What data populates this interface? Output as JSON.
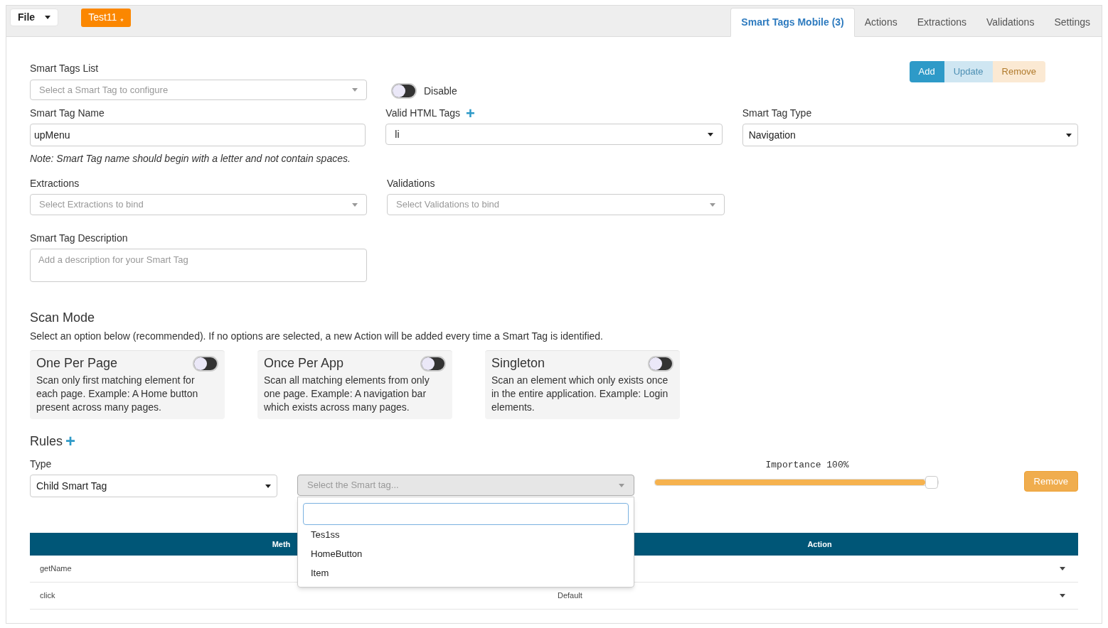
{
  "toolbar": {
    "file_menu": "File",
    "doc_tab": {
      "label": "Test11",
      "modified_mark": "*"
    }
  },
  "tabs": [
    {
      "label": "Smart Tags Mobile (3)",
      "selected": true
    },
    {
      "label": "Actions",
      "selected": false
    },
    {
      "label": "Extractions",
      "selected": false
    },
    {
      "label": "Validations",
      "selected": false
    },
    {
      "label": "Settings",
      "selected": false
    }
  ],
  "smart_tags_list": {
    "label": "Smart Tags List",
    "placeholder": "Select a Smart Tag to configure"
  },
  "disable_toggle": {
    "label": "Disable",
    "on": false
  },
  "action_buttons": [
    {
      "label": "Add",
      "kind": "primary",
      "disabled": false
    },
    {
      "label": "Update",
      "kind": "info",
      "disabled": true
    },
    {
      "label": "Remove",
      "kind": "warning",
      "disabled": true
    }
  ],
  "smart_tag_name": {
    "label": "Smart Tag Name",
    "value": "upMenu",
    "note": "Note: Smart Tag name should begin with a letter and not contain spaces."
  },
  "valid_html_tags": {
    "label": "Valid HTML Tags",
    "add_icon": "+",
    "value": "li"
  },
  "smart_tag_type": {
    "label": "Smart Tag Type",
    "value": "Navigation"
  },
  "extractions": {
    "label": "Extractions",
    "placeholder": "Select Extractions to bind"
  },
  "validations": {
    "label": "Validations",
    "placeholder": "Select Validations to bind"
  },
  "description": {
    "label": "Smart Tag Description",
    "placeholder": "Add a description for your Smart Tag"
  },
  "scan_mode": {
    "title": "Scan Mode",
    "text": "Select an option below (recommended). If no options are selected, a new Action will be added every time a Smart Tag is identified.",
    "options": [
      {
        "title": "One Per Page",
        "text": "Scan only first matching element for each page. Example: A Home button present across many pages.",
        "on": false
      },
      {
        "title": "Once Per App",
        "text": "Scan all matching elements from only one page. Example: A navigation bar which exists across many pages.",
        "on": false
      },
      {
        "title": "Singleton",
        "text": "Scan an element which only exists once in the entire application. Example: Login elements.",
        "on": false
      }
    ]
  },
  "rules": {
    "title": "Rules",
    "add_icon": "+",
    "type_label": "Type",
    "type_value": "Child Smart Tag",
    "smart_tag_select": {
      "placeholder": "Select the Smart tag...",
      "expanded": true,
      "options": [
        "Tes1ss",
        "HomeButton",
        "Item"
      ]
    },
    "importance": {
      "label": "Importance 100%",
      "level": 1.0
    },
    "remove_button": "Remove"
  },
  "table": {
    "columns": [
      "Meth",
      "Action"
    ],
    "rows": [
      {
        "method": "getName"
      },
      {
        "method": "click",
        "action": "Default"
      }
    ]
  }
}
